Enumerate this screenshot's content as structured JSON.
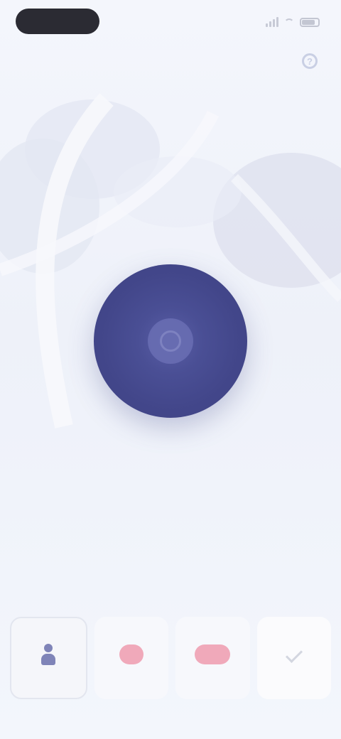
{
  "status_bar": {
    "time": "",
    "signal_icon": "signal-bars-icon",
    "wifi_icon": "wifi-icon",
    "battery_icon": "battery-icon"
  },
  "header": {
    "title": "",
    "action_icon": "help-icon"
  },
  "main": {
    "button_icon": "target-icon",
    "caption": ""
  },
  "bottom_actions": [
    {
      "icon": "person-icon",
      "label": "",
      "state": "active"
    },
    {
      "icon": "heart-icon",
      "label": ""
    },
    {
      "icon": "heart-icon",
      "label": ""
    },
    {
      "icon": "edit-icon",
      "label": ""
    }
  ],
  "colors": {
    "accent": "#43478b",
    "accent_light": "#6a6fb4",
    "pink": "#f0a9ba",
    "background": "#f1f4fb"
  }
}
